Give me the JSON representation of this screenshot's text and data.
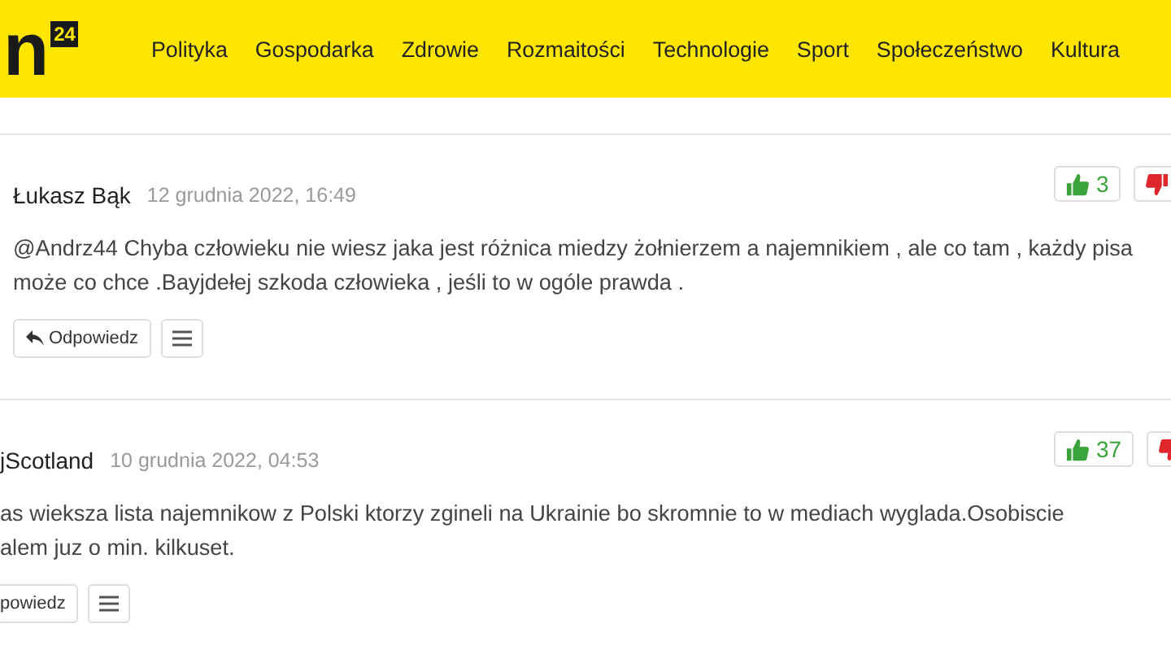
{
  "header": {
    "logo_text": "n",
    "logo_badge": "24",
    "nav": [
      "Polityka",
      "Gospodarka",
      "Zdrowie",
      "Rozmaitości",
      "Technologie",
      "Sport",
      "Społeczeństwo",
      "Kultura"
    ]
  },
  "comments": [
    {
      "author": "Łukasz Bąk",
      "date": "12 grudnia 2022, 16:49",
      "text": "@Andrz44 Chyba człowieku nie wiesz jaka jest różnica miedzy żołnierzem a najemnikiem , ale co tam , każdy pisa\nmoże co chce .Bayjdełej szkoda człowieka , jeśli to w ogóle prawda .",
      "likes": "3",
      "reply_label": "Odpowiedz",
      "cut_left": false
    },
    {
      "author": "jScotland",
      "date": "10 grudnia 2022, 04:53",
      "text": "as wieksza lista najemnikow z Polski ktorzy zgineli na Ukrainie bo skromnie to w mediach wyglada.Osobiscie\nalem juz o min. kilkuset.",
      "likes": "37",
      "reply_label": "powiedz",
      "cut_left": true
    }
  ]
}
